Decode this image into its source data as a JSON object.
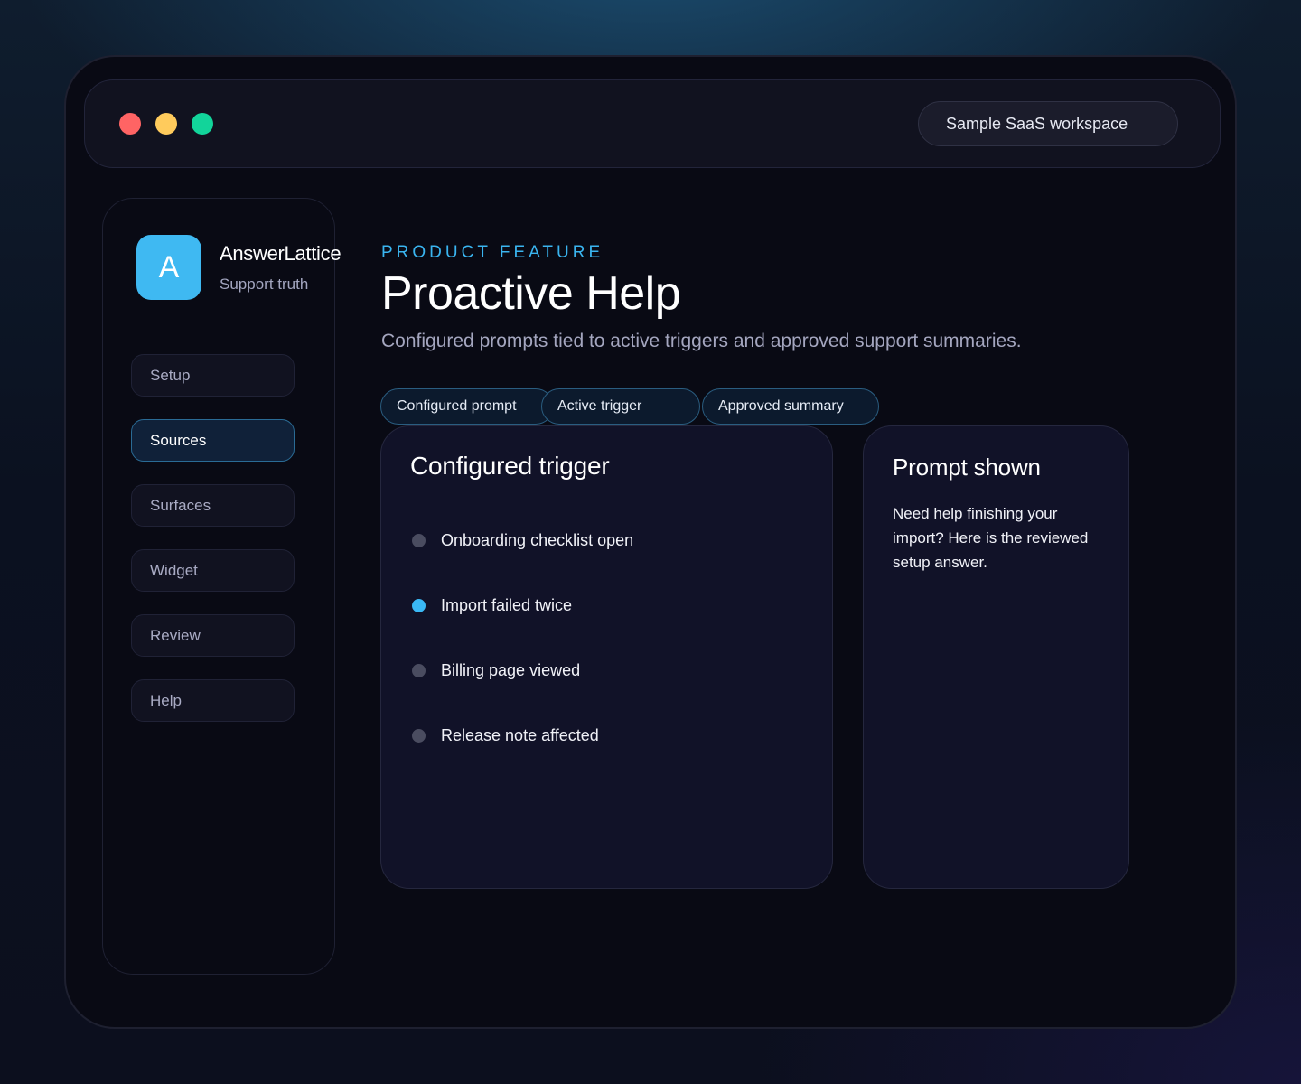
{
  "window": {
    "controls": [
      {
        "name": "close",
        "color": "#ff6464"
      },
      {
        "name": "minimize",
        "color": "#ffcb5c"
      },
      {
        "name": "maximize",
        "color": "#12d49a"
      }
    ],
    "workspace_label": "Sample SaaS workspace"
  },
  "sidebar": {
    "logo_letter": "A",
    "brand_name": "AnswerLattice",
    "brand_tagline": "Support truth",
    "items": [
      {
        "label": "Setup",
        "active": false
      },
      {
        "label": "Sources",
        "active": true
      },
      {
        "label": "Surfaces",
        "active": false
      },
      {
        "label": "Widget",
        "active": false
      },
      {
        "label": "Review",
        "active": false
      },
      {
        "label": "Help",
        "active": false
      }
    ]
  },
  "main": {
    "eyebrow": "PRODUCT FEATURE",
    "title": "Proactive Help",
    "subtitle": "Configured prompts tied to active triggers and approved support summaries.",
    "chips": [
      "Configured prompt",
      "Active trigger",
      "Approved summary"
    ],
    "trigger_card": {
      "title": "Configured trigger",
      "triggers": [
        {
          "label": "Onboarding checklist open",
          "active": false
        },
        {
          "label": "Import failed twice",
          "active": true
        },
        {
          "label": "Billing page viewed",
          "active": false
        },
        {
          "label": "Release note affected",
          "active": false
        }
      ]
    },
    "prompt_card": {
      "title": "Prompt shown",
      "text": "Need help finishing your import? Here is the reviewed setup answer."
    }
  },
  "colors": {
    "accent": "#3ab5f0",
    "logo": "#3fb9f2",
    "active_dot": "#3ab8f5",
    "inactive_dot": "#4a4c60"
  }
}
